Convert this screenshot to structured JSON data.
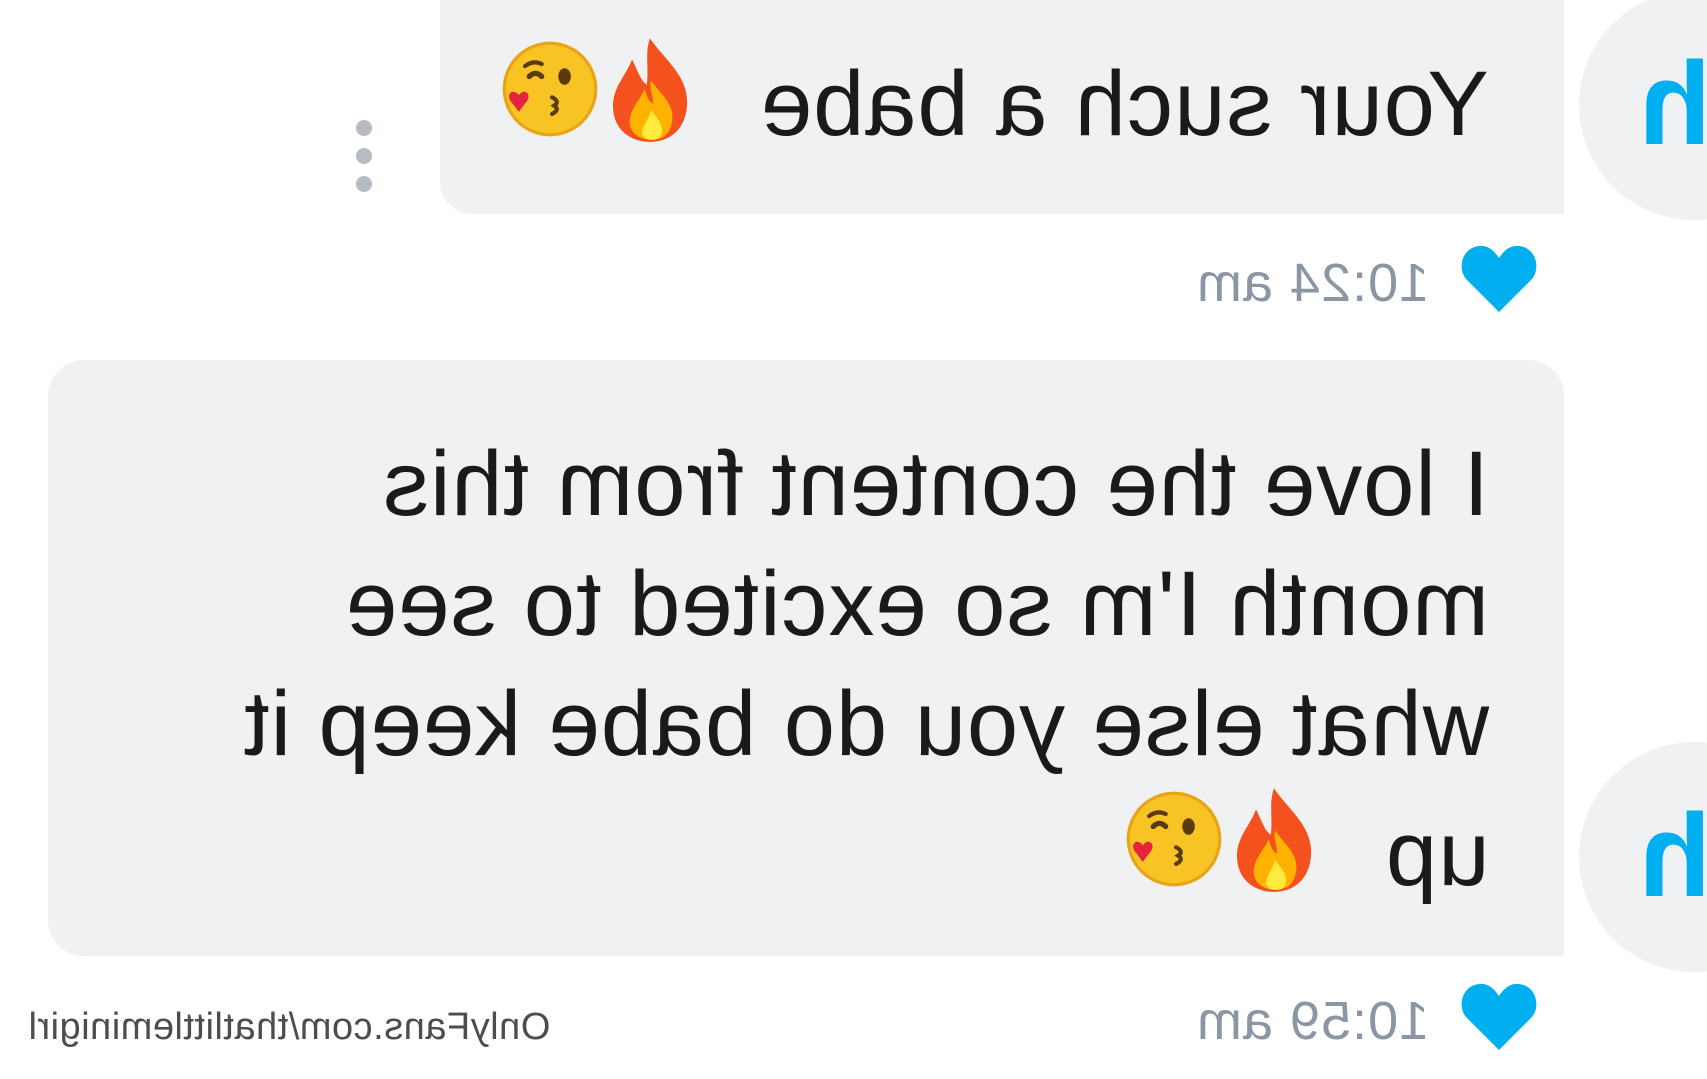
{
  "messages": [
    {
      "text": "Your such a babe",
      "emojis": [
        "fire-emoji",
        "kiss-emoji"
      ],
      "time": "10:24 am"
    },
    {
      "lines": [
        "I love the content from this",
        "month I'm so excited to see",
        "what else you do babe keep it",
        "up"
      ],
      "emojis": [
        "fire-emoji",
        "kiss-emoji"
      ],
      "time": "10:59 am"
    }
  ],
  "avatars": [
    {
      "initial": "h"
    },
    {
      "initial": "h"
    }
  ],
  "watermark": "OnlyFans.com/thatlittleminigirl",
  "colors": {
    "bubble": "#eff1f2",
    "heart": "#00aff0",
    "timestamp": "#8a96a3",
    "avatar_initial": "#00aff0"
  }
}
